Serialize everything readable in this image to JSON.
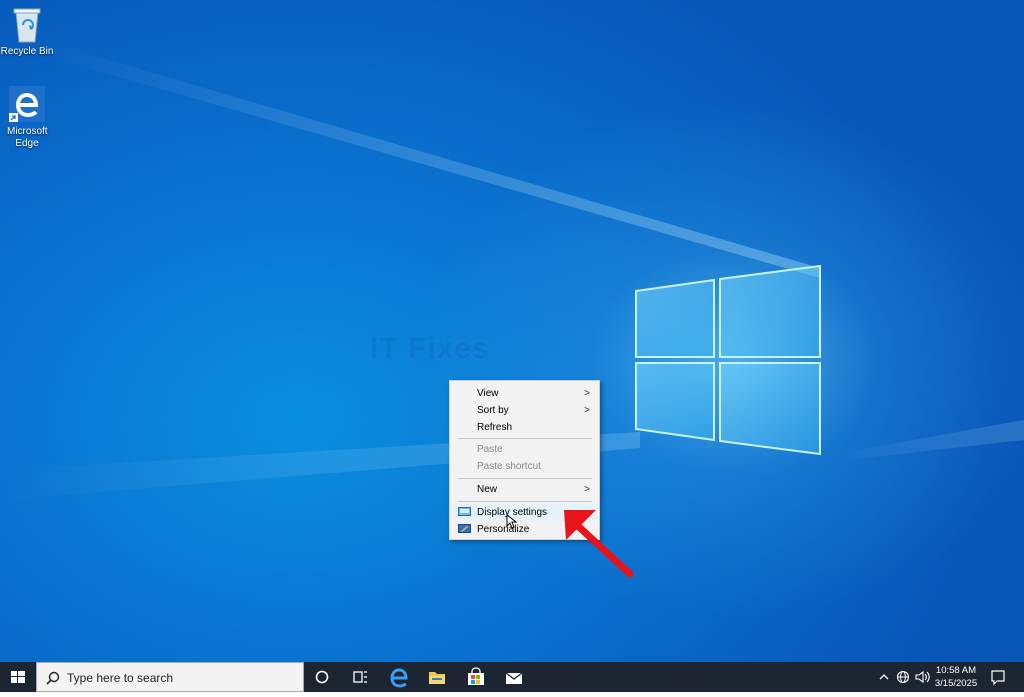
{
  "desktop": {
    "icons": [
      {
        "label": "Recycle Bin"
      },
      {
        "label": "Microsoft Edge"
      }
    ],
    "watermark": "IT Fixes"
  },
  "context_menu": {
    "items": [
      {
        "label": "View",
        "submenu": true,
        "enabled": true
      },
      {
        "label": "Sort by",
        "submenu": true,
        "enabled": true
      },
      {
        "label": "Refresh",
        "enabled": true
      },
      {
        "label": "Paste",
        "enabled": false
      },
      {
        "label": "Paste shortcut",
        "enabled": false
      },
      {
        "label": "New",
        "submenu": true,
        "enabled": true
      },
      {
        "label": "Display settings",
        "enabled": true,
        "highlighted": true,
        "icon": "display-icon"
      },
      {
        "label": "Personalize",
        "enabled": true,
        "icon": "personalize-icon"
      }
    ],
    "submenu_arrow": ">"
  },
  "taskbar": {
    "search_placeholder": "Type here to search",
    "clock": {
      "time": "10:58 AM",
      "date": "3/15/2025"
    },
    "accent_color": "#1c2633"
  },
  "annotation": {
    "arrow_color": "#e8141c"
  }
}
